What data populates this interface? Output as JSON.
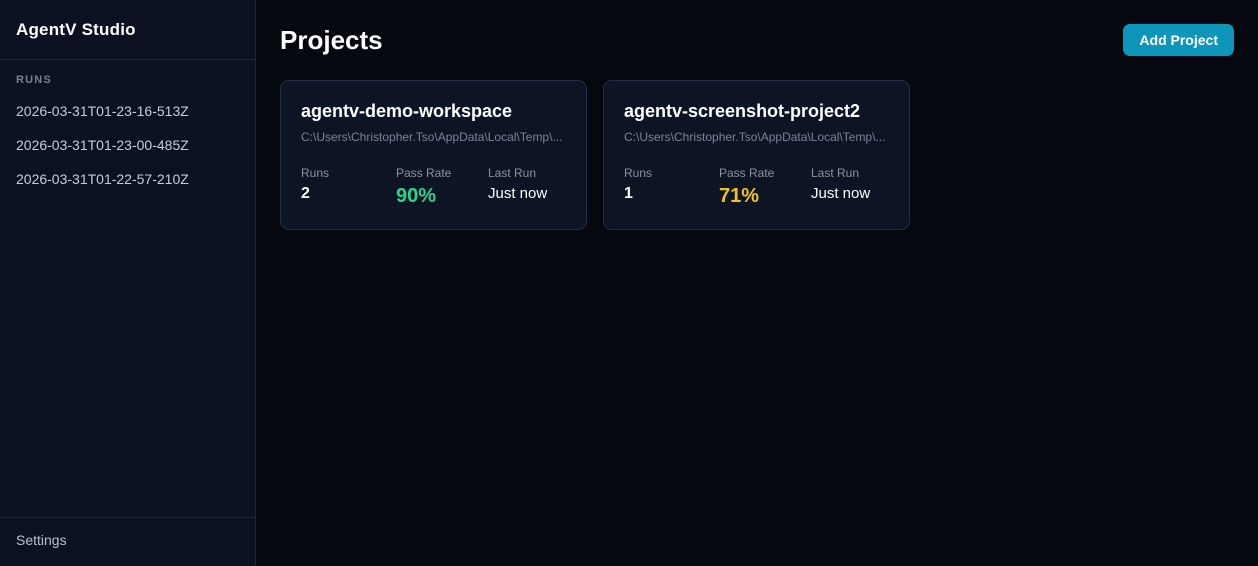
{
  "sidebar": {
    "title": "AgentV Studio",
    "runs_header": "RUNS",
    "runs": [
      "2026-03-31T01-23-16-513Z",
      "2026-03-31T01-23-00-485Z",
      "2026-03-31T01-22-57-210Z"
    ],
    "settings_label": "Settings"
  },
  "main": {
    "title": "Projects",
    "add_project_label": "Add Project"
  },
  "projects": [
    {
      "name": "agentv-demo-workspace",
      "path": "C:\\Users\\Christopher.Tso\\AppData\\Local\\Temp\\...",
      "runs_label": "Runs",
      "runs_value": "2",
      "pass_rate_label": "Pass Rate",
      "pass_rate_value": "90%",
      "pass_rate_color": "#2ed38e",
      "last_run_label": "Last Run",
      "last_run_value": "Just now"
    },
    {
      "name": "agentv-screenshot-project2",
      "path": "C:\\Users\\Christopher.Tso\\AppData\\Local\\Temp\\...",
      "runs_label": "Runs",
      "runs_value": "1",
      "pass_rate_label": "Pass Rate",
      "pass_rate_value": "71%",
      "pass_rate_color": "#f1c31b",
      "last_run_label": "Last Run",
      "last_run_value": "Just now"
    }
  ],
  "colors": {
    "accent_button": "#0e95ba",
    "pass_rate_green": "#2ed38e",
    "pass_rate_yellow": "#f1c31b",
    "sidebar_bg": "#0b1120",
    "main_bg": "#05080f",
    "card_bg": "#0d1524",
    "card_border": "#232d44"
  }
}
